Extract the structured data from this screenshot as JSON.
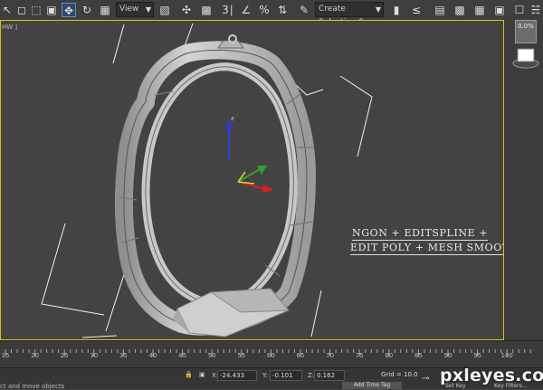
{
  "toolbar": {
    "view_dropdown": "View",
    "selection_set_placeholder": "Create Selection S",
    "icons": [
      "select-arrow-icon",
      "select-region-icon",
      "window-crossing-icon",
      "select-move-icon",
      "select-rotate-icon",
      "select-scale-icon",
      "pivot-icon",
      "snap-toggle-icon",
      "angle-snap-icon",
      "percent-snap-icon",
      "spinner-snap-icon",
      "mirror-icon",
      "align-icon",
      "curve-editor-icon",
      "render-setup-icon",
      "render-icon"
    ]
  },
  "viewport": {
    "label": "HW ]",
    "annotation_line1": "NGON + EDITSPLINE +",
    "annotation_line2": "EDIT POLY + MESH SMOOTH",
    "gizmo_axis_label": "z"
  },
  "view_cube": {
    "percent": "0.0%"
  },
  "timeline": {
    "ticks": [
      "15",
      "20",
      "25",
      "30",
      "35",
      "40",
      "45",
      "50",
      "55",
      "60",
      "65",
      "70",
      "75",
      "80",
      "85",
      "90",
      "95",
      "100"
    ]
  },
  "status": {
    "x_label": "X:",
    "x_value": "-24.433",
    "y_label": "Y:",
    "y_value": "-0.101",
    "z_label": "Z:",
    "z_value": "0.162",
    "grid": "Grid = 10.0",
    "prompt": "ct and move objects",
    "add_time_tag": "Add Time Tag",
    "set_key": "Set Key",
    "key_filters": "Key Filters..."
  },
  "watermark": "pxleyes.com",
  "colors": {
    "viewport_bg": "#434343",
    "viewport_border": "#d9c21a",
    "ring": "#bdbdbd",
    "gizmo_x": "#d42020",
    "gizmo_y": "#2fa12f",
    "gizmo_z": "#2a3fd0"
  }
}
